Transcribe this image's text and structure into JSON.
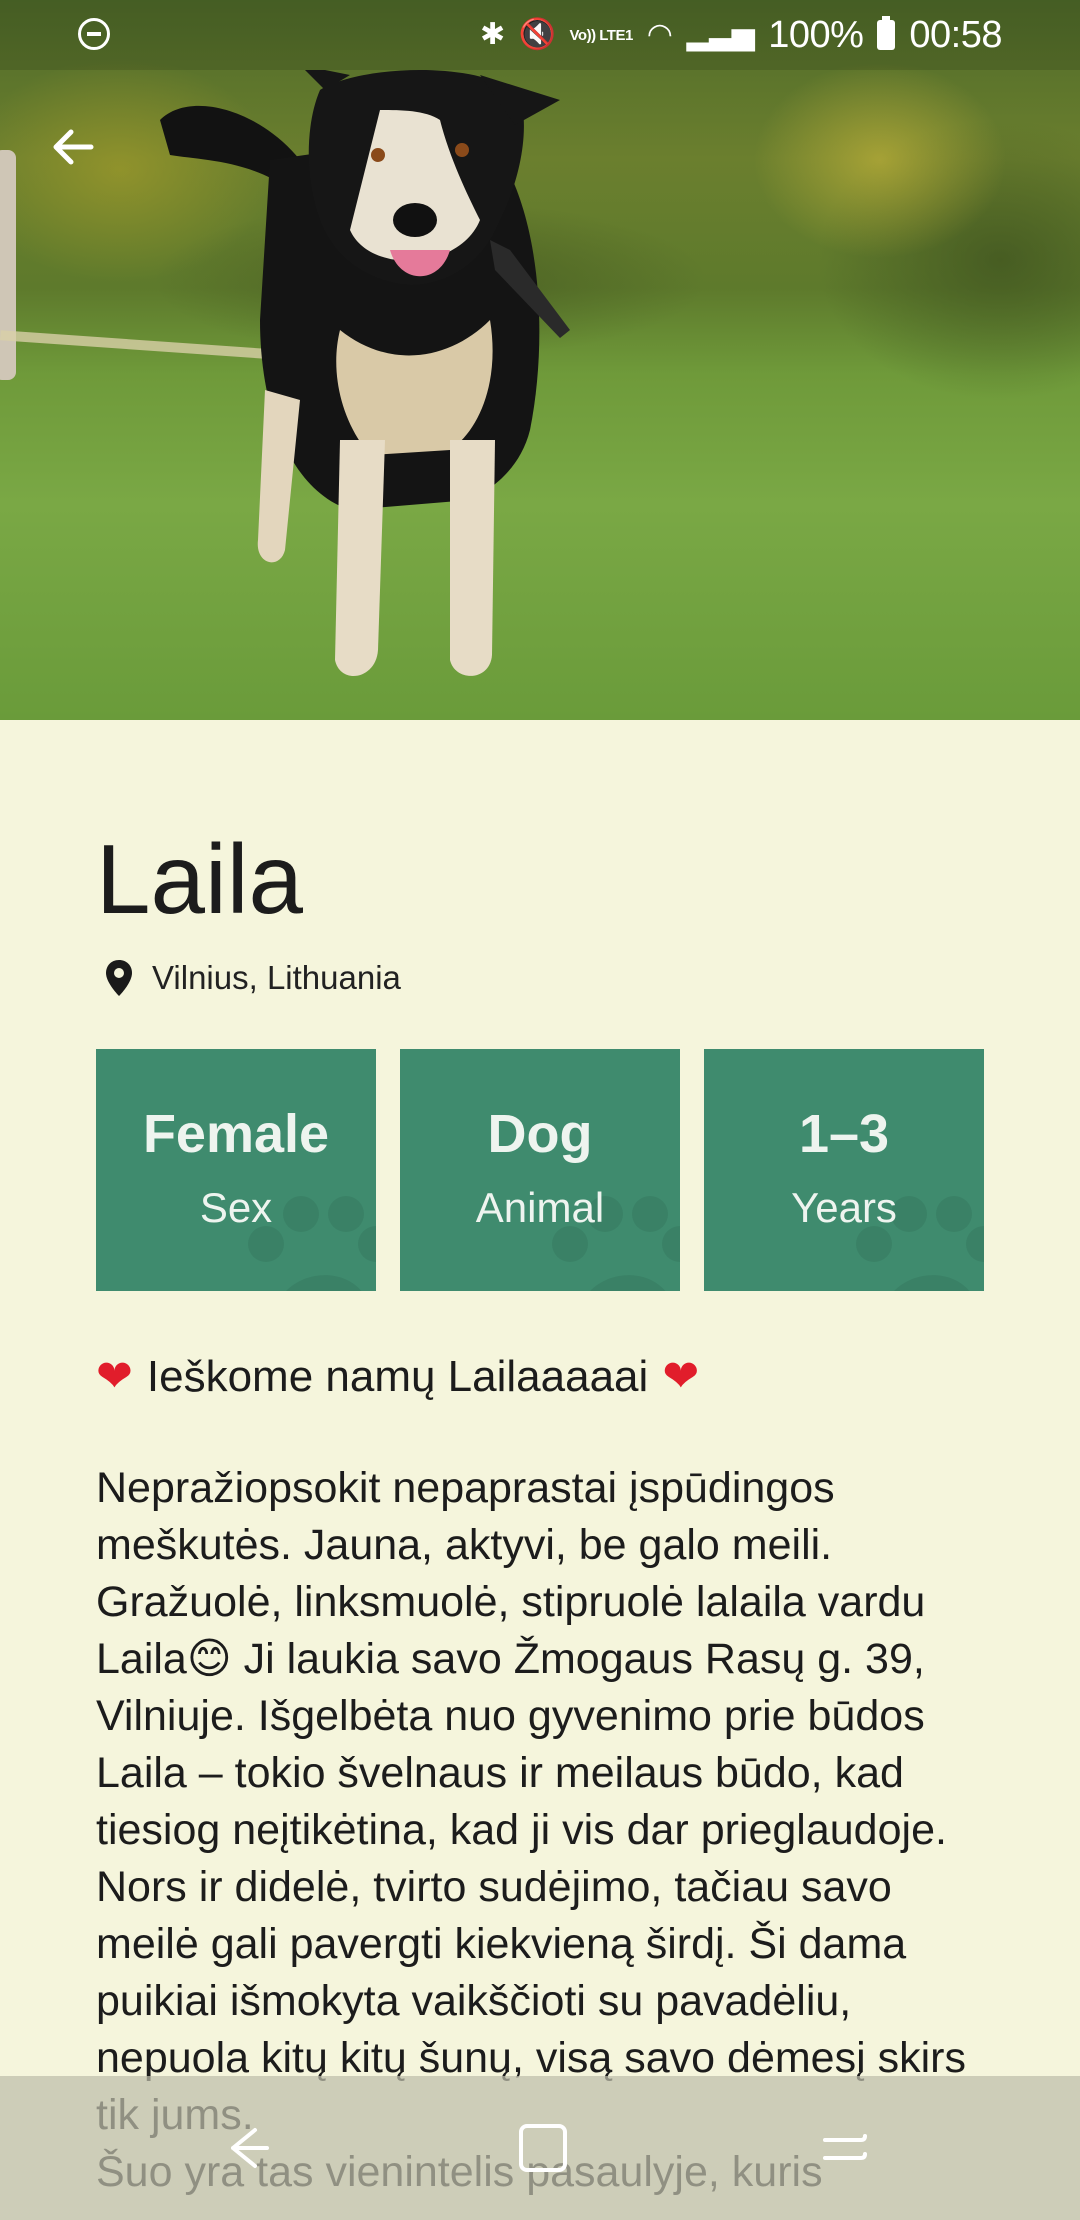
{
  "status_bar": {
    "battery_text": "100%",
    "time": "00:58",
    "network_label": "Vo)) LTE1"
  },
  "pet": {
    "name": "Laila",
    "location": "Vilnius, Lithuania",
    "tiles": [
      {
        "value": "Female",
        "label": "Sex"
      },
      {
        "value": "Dog",
        "label": "Animal"
      },
      {
        "value": "1–3",
        "label": "Years"
      }
    ],
    "headline": "Ieškome namų Lailaaaaai",
    "description": "Nepražiopsokit nepaprastai įspūdingos meškutės. Jauna, aktyvi, be galo meili. Gražuolė, linksmuolė, stipruolė lalaila vardu Laila😊 Ji laukia savo Žmogaus Rasų g. 39, Vilniuje. Išgelbėta nuo gyvenimo prie būdos Laila – tokio švelnaus ir meilaus būdo, kad tiesiog neįtikėtina, kad ji vis dar prieglaudoje. Nors ir didelė, tvirto sudėjimo, tačiau savo meilė gali pavergti kiekvieną širdį. Ši dama puikiai išmokyta vaikščioti su pavadėliu, nepuola kitų kitų šunų, visą savo dėmesį skirs tik jums.\nŠuo yra tas vienintelis pasaulyje, kuris"
  },
  "colors": {
    "background": "#f5f5dc",
    "tile": "#3f8b6e",
    "heart": "#e11d2b"
  },
  "icons": {
    "back": "arrow-left-icon",
    "location": "location-pin-icon",
    "tile_decoration": "paw-icon"
  }
}
